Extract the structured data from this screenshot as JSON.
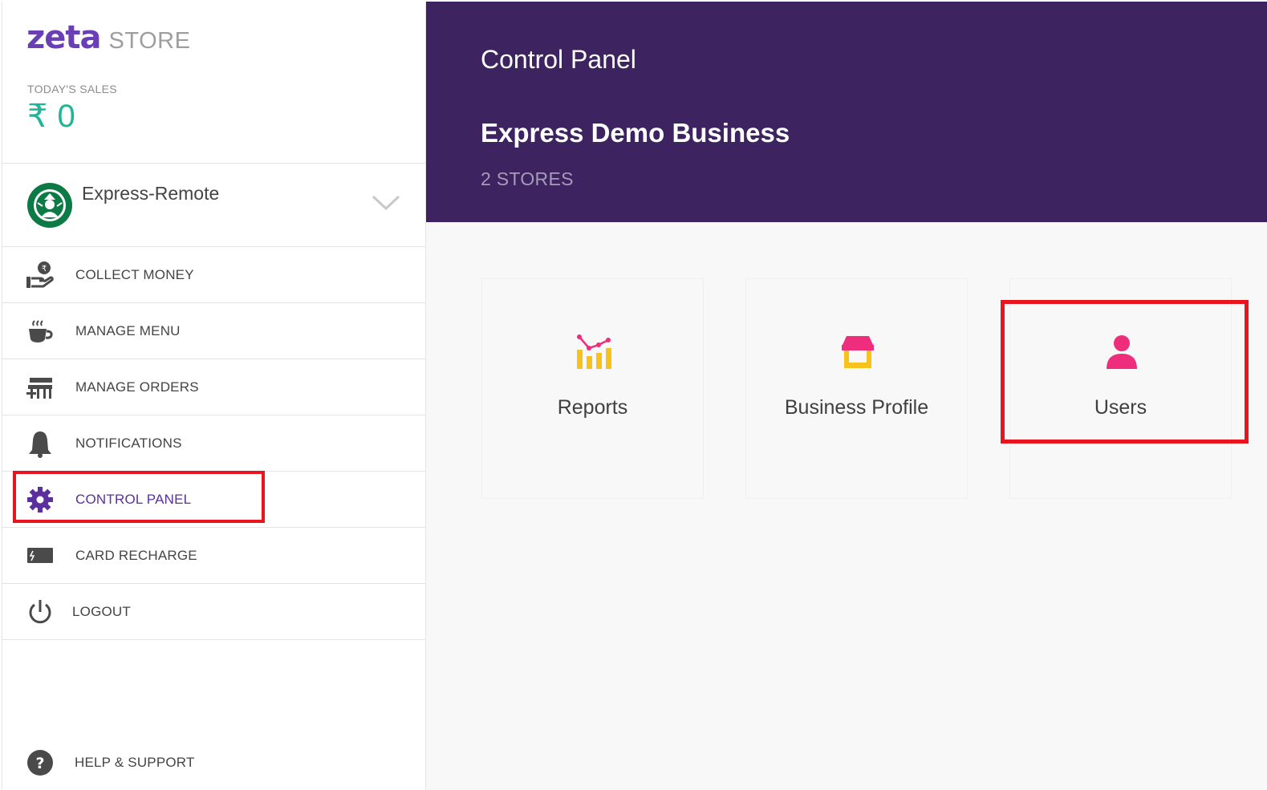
{
  "brand": {
    "logo_text": "zeta",
    "product": "STORE"
  },
  "sales": {
    "label": "TODAY'S SALES",
    "currency": "₹",
    "amount": "0"
  },
  "store_selector": {
    "name": "Express-Remote",
    "logo": "starbucks-logo-icon",
    "chevron": "chevron-down-icon"
  },
  "menu": {
    "items": [
      {
        "label": "COLLECT MONEY",
        "icon": "hand-coin-icon"
      },
      {
        "label": "MANAGE MENU",
        "icon": "coffee-cup-icon"
      },
      {
        "label": "MANAGE ORDERS",
        "icon": "counter-icon"
      },
      {
        "label": "NOTIFICATIONS",
        "icon": "bell-icon"
      },
      {
        "label": "CONTROL PANEL",
        "icon": "gear-icon",
        "active": true
      },
      {
        "label": "CARD RECHARGE",
        "icon": "card-icon"
      },
      {
        "label": "LOGOUT",
        "icon": "power-icon"
      }
    ],
    "help_label": "HELP & SUPPORT"
  },
  "header": {
    "title": "Control Panel",
    "business_name": "Express Demo Business",
    "store_count": "2 STORES"
  },
  "cards": [
    {
      "label": "Reports",
      "icon": "chart-icon"
    },
    {
      "label": "Business Profile",
      "icon": "storefront-icon"
    },
    {
      "label": "Users",
      "icon": "user-icon"
    }
  ],
  "colors": {
    "brand_purple": "#6a3fb5",
    "header_bg": "#3d2460",
    "sales_green": "#1fb597",
    "highlight_red": "#e8141e",
    "icon_yellow": "#f7c21b",
    "icon_pink": "#ee2d7c"
  }
}
